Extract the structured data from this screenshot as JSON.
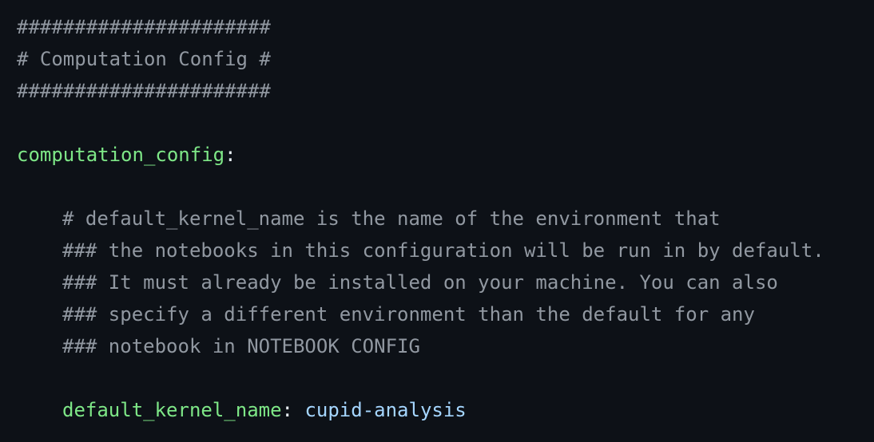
{
  "lines": {
    "hash_top": "######################",
    "header_comment": "# Computation Config #",
    "hash_bottom": "######################",
    "section_key": "computation_config",
    "colon": ":",
    "comment_1": "# default_kernel_name is the name of the environment that",
    "comment_2": "### the notebooks in this configuration will be run in by default.",
    "comment_3": "### It must already be installed on your machine. You can also",
    "comment_4": "### specify a different environment than the default for any",
    "comment_5": "### notebook in NOTEBOOK CONFIG",
    "kernel_key": "default_kernel_name",
    "kernel_sep": ": ",
    "kernel_value": "cupid-analysis"
  },
  "colors": {
    "background": "#0d1117",
    "comment": "#9198a1",
    "key": "#7ee787",
    "value": "#a5d6ff",
    "punctuation": "#e6edf3"
  }
}
